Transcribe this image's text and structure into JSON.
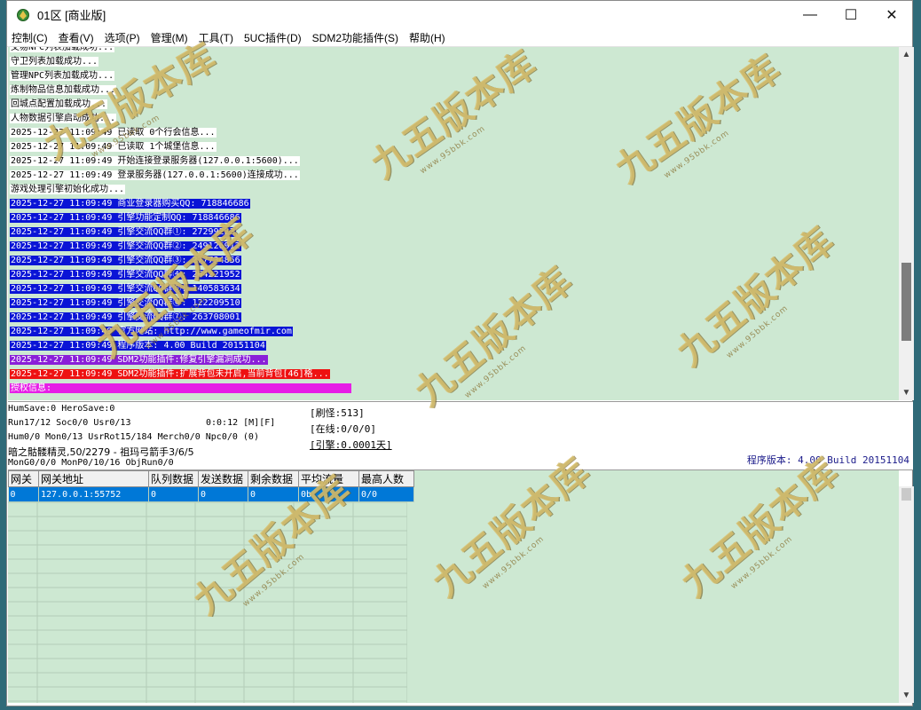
{
  "window": {
    "title": "01区 [商业版]",
    "controls": {
      "minimize": "—",
      "maximize": "☐",
      "close": "✕"
    }
  },
  "menu": [
    "控制(C)",
    "查看(V)",
    "选项(P)",
    "管理(M)",
    "工具(T)",
    "5UC插件(D)",
    "SDM2功能插件(S)",
    "帮助(H)"
  ],
  "log": [
    {
      "text": "交易NPC列表加载成功...",
      "style": "plain"
    },
    {
      "text": "守卫列表加载成功...",
      "style": "plain"
    },
    {
      "text": "管理NPC列表加载成功...",
      "style": "plain"
    },
    {
      "text": "炼制物品信息加载成功...",
      "style": "plain"
    },
    {
      "text": "回城点配置加载成功...",
      "style": "plain"
    },
    {
      "text": "人物数据引擎启动成功...",
      "style": "plain"
    },
    {
      "text": "2025-12-27 11:09:49 已读取 0个行会信息...",
      "style": "plain"
    },
    {
      "text": "2025-12-27 11:09:49 已读取 1个城堡信息...",
      "style": "plain"
    },
    {
      "text": "2025-12-27 11:09:49 开始连接登录服务器(127.0.0.1:5600)...",
      "style": "plain"
    },
    {
      "text": "2025-12-27 11:09:49 登录服务器(127.0.0.1:5600)连接成功...",
      "style": "plain"
    },
    {
      "text": "游戏处理引擎初始化成功...",
      "style": "plain"
    },
    {
      "text": "2025-12-27 11:09:49 商业登录器购买QQ: 718846686",
      "style": "blue"
    },
    {
      "text": "2025-12-27 11:09:49 引擎功能定制QQ: 718846686",
      "style": "blue"
    },
    {
      "text": "2025-12-27 11:09:49 引擎交流QQ群①: 27299223",
      "style": "blue"
    },
    {
      "text": "2025-12-27 11:09:49 引擎交流QQ群②: 249126912",
      "style": "blue"
    },
    {
      "text": "2025-12-27 11:09:49 引擎交流QQ群③: 277734856",
      "style": "blue"
    },
    {
      "text": "2025-12-27 11:09:49 引擎交流QQ群④: 264221952",
      "style": "blue"
    },
    {
      "text": "2025-12-27 11:09:49 引擎交流QQ群⑤: 140583634",
      "style": "blue"
    },
    {
      "text": "2025-12-27 11:09:49 引擎交流QQ群⑥: 122209510",
      "style": "blue"
    },
    {
      "text": "2025-12-27 11:09:49 引擎交流QQ群⑦: 263708001",
      "style": "blue"
    },
    {
      "text": "2025-12-27 11:09:49 官方网站: http://www.gameofmir.com",
      "style": "blue"
    },
    {
      "text": "2025-12-27 11:09:49 程序版本: 4.00 Build 20151104",
      "style": "blue"
    },
    {
      "text": "2025-12-27 11:09:49 SDM2功能插件:修复引擎漏洞成功...",
      "style": "purple"
    },
    {
      "text": "2025-12-27 11:09:49 SDM2功能插件:扩展背包未开启,当前背包[46]格...",
      "style": "red"
    },
    {
      "text": "授权信息:                                                        ",
      "style": "magenta"
    }
  ],
  "status": {
    "line1": "HumSave:0 HeroSave:0",
    "line2": "Run17/12 Soc0/0 Usr0/13",
    "timer": "0:0:12 [M][F]",
    "line3": "Hum0/0 Mon0/13 UsrRot15/184 Merch0/0 Npc0/0 (0)",
    "line4": "暗之骷髅精灵,50/2279 - 祖玛弓箭手3/6/5",
    "line5": "MonG0/0/0 MonP0/10/16 ObjRun0/0",
    "refresh": "[刷怪:513]",
    "online": "[在线:0/0/0]",
    "engine": "[引擎:0.0001天]",
    "version": "程序版本: 4.00 Build 20151104"
  },
  "gateway_table": {
    "columns": [
      "网关",
      "网关地址",
      "队列数据",
      "发送数据",
      "剩余数据",
      "平均流量",
      "最高人数"
    ],
    "rows": [
      [
        "0",
        "127.0.0.1:55752",
        "0",
        "0",
        "0",
        "0b",
        "0/0"
      ]
    ]
  },
  "watermark": {
    "text": "九五版本库",
    "url": "www.95bbk.com"
  },
  "colors": {
    "log_bg": "#cde8d2",
    "blue": "#0a14d6",
    "purple": "#8a1fd8",
    "red": "#ee1111",
    "magenta": "#e61ee6",
    "selected": "#0078d7"
  },
  "icons": {
    "app": "mir-server-icon",
    "scroll_up": "scroll-up-arrow-icon",
    "scroll_down": "scroll-down-arrow-icon"
  }
}
